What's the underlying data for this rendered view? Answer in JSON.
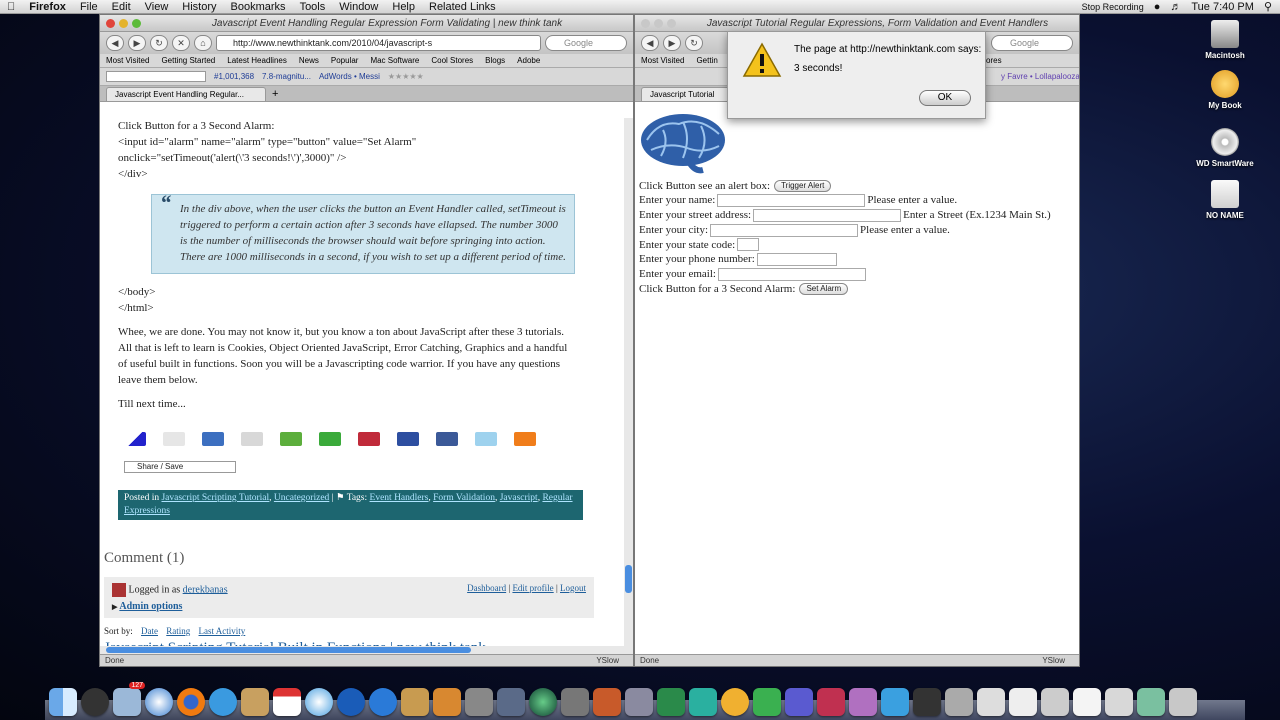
{
  "menubar": {
    "app": "Firefox",
    "items": [
      "File",
      "Edit",
      "View",
      "History",
      "Bookmarks",
      "Tools",
      "Window",
      "Help",
      "Related Links"
    ],
    "recording": "Stop Recording",
    "clock": "Tue 7:40 PM"
  },
  "left_window": {
    "title": "Javascript Event Handling Regular Expression Form Validating | new think tank",
    "url": "http://www.newthinktank.com/2010/04/javascript-s",
    "search_placeholder": "Google",
    "bookmarks": [
      "Most Visited",
      "Getting Started",
      "Latest Headlines",
      "News",
      "Popular",
      "Mac Software",
      "Cool Stores",
      "Blogs",
      "Adobe"
    ],
    "addon_items": [
      "#1,001,368",
      "7.8-magnitu...",
      "AdWords • Messi"
    ],
    "tab_label": "Javascript Event Handling Regular...",
    "status": "Done",
    "yslow": "YSlow",
    "code_lines": [
      "Click Button for a 3 Second Alarm:",
      "<input id=\"alarm\" name=\"alarm\" type=\"button\" value=\"Set Alarm\"",
      "onclick=\"setTimeout('alert(\\'3 seconds!\\')',3000)\" />",
      "</div>"
    ],
    "quote": "In the div above, when the user clicks the button an Event Handler called, setTimeout is triggered to perform a certain action after 3 seconds have ellapsed. The number 3000 is the number of milliseconds the browser should wait before springing into action. There are 1000 milliseconds in a second, if you wish to set up a different period of time.",
    "code_lines_2": [
      "</body>",
      "</html>"
    ],
    "paragraph": "Whee, we are done. You may not know it, but you know a ton about JavaScript after these 3 tutorials. All that is left to learn is Cookies, Object Oriented JavaScript, Error Catching, Graphics and a handful of useful built in functions. Soon you will be a Javascripting code warrior. If you have any questions leave them below.",
    "till_next": "Till next time...",
    "share_save": "Share / Save",
    "posted_in_label": "Posted in",
    "posted_in": [
      "Javascript Scripting Tutorial",
      "Uncategorized"
    ],
    "tags_label": "Tags:",
    "tags": [
      "Event Handlers",
      "Form Validation",
      "Javascript",
      "Regular Expressions"
    ],
    "comment_heading": "Comment (1)",
    "logged_in_as": "Logged in as",
    "username": "derekbanas",
    "dashboard": "Dashboard",
    "edit_profile": "Edit profile",
    "logout": "Logout",
    "admin_options": "Admin options",
    "sort_by": "Sort by:",
    "sort_options": [
      "Date",
      "Rating",
      "Last Activity"
    ],
    "related_title": "Javascript Scripting Tutorial Built in Functions | new think tank"
  },
  "right_window": {
    "title": "Javascript Tutorial Regular Expressions, Form Validation and Event Handlers",
    "search_placeholder": "Google",
    "bookmarks": [
      "Most Visited",
      "Gettin",
      "Cool Stores"
    ],
    "addon_text": "y Favre • Lollapalooza 2...",
    "tab_label": "Javascript Tutorial",
    "status": "Done",
    "yslow": "YSlow",
    "alert_label": "Click Button see an alert box:",
    "trigger_alert": "Trigger Alert",
    "fields": [
      {
        "label": "Enter your name:",
        "note": "Please enter a value."
      },
      {
        "label": "Enter your street address:",
        "note": "Enter a Street (Ex.1234 Main St.)"
      },
      {
        "label": "Enter your city:",
        "note": "Please enter a value."
      },
      {
        "label": "Enter your state code:",
        "note": ""
      },
      {
        "label": "Enter your phone number:",
        "note": ""
      },
      {
        "label": "Enter your email:",
        "note": ""
      }
    ],
    "alarm_label": "Click Button for a 3 Second Alarm:",
    "set_alarm": "Set Alarm"
  },
  "dialog": {
    "line1": "The page at http://newthinktank.com says:",
    "line2": "3 seconds!",
    "ok": "OK"
  },
  "desktop_icons": [
    "Macintosh",
    "My Book",
    "WD SmartWare",
    "NO NAME"
  ],
  "dock_badge": "127"
}
